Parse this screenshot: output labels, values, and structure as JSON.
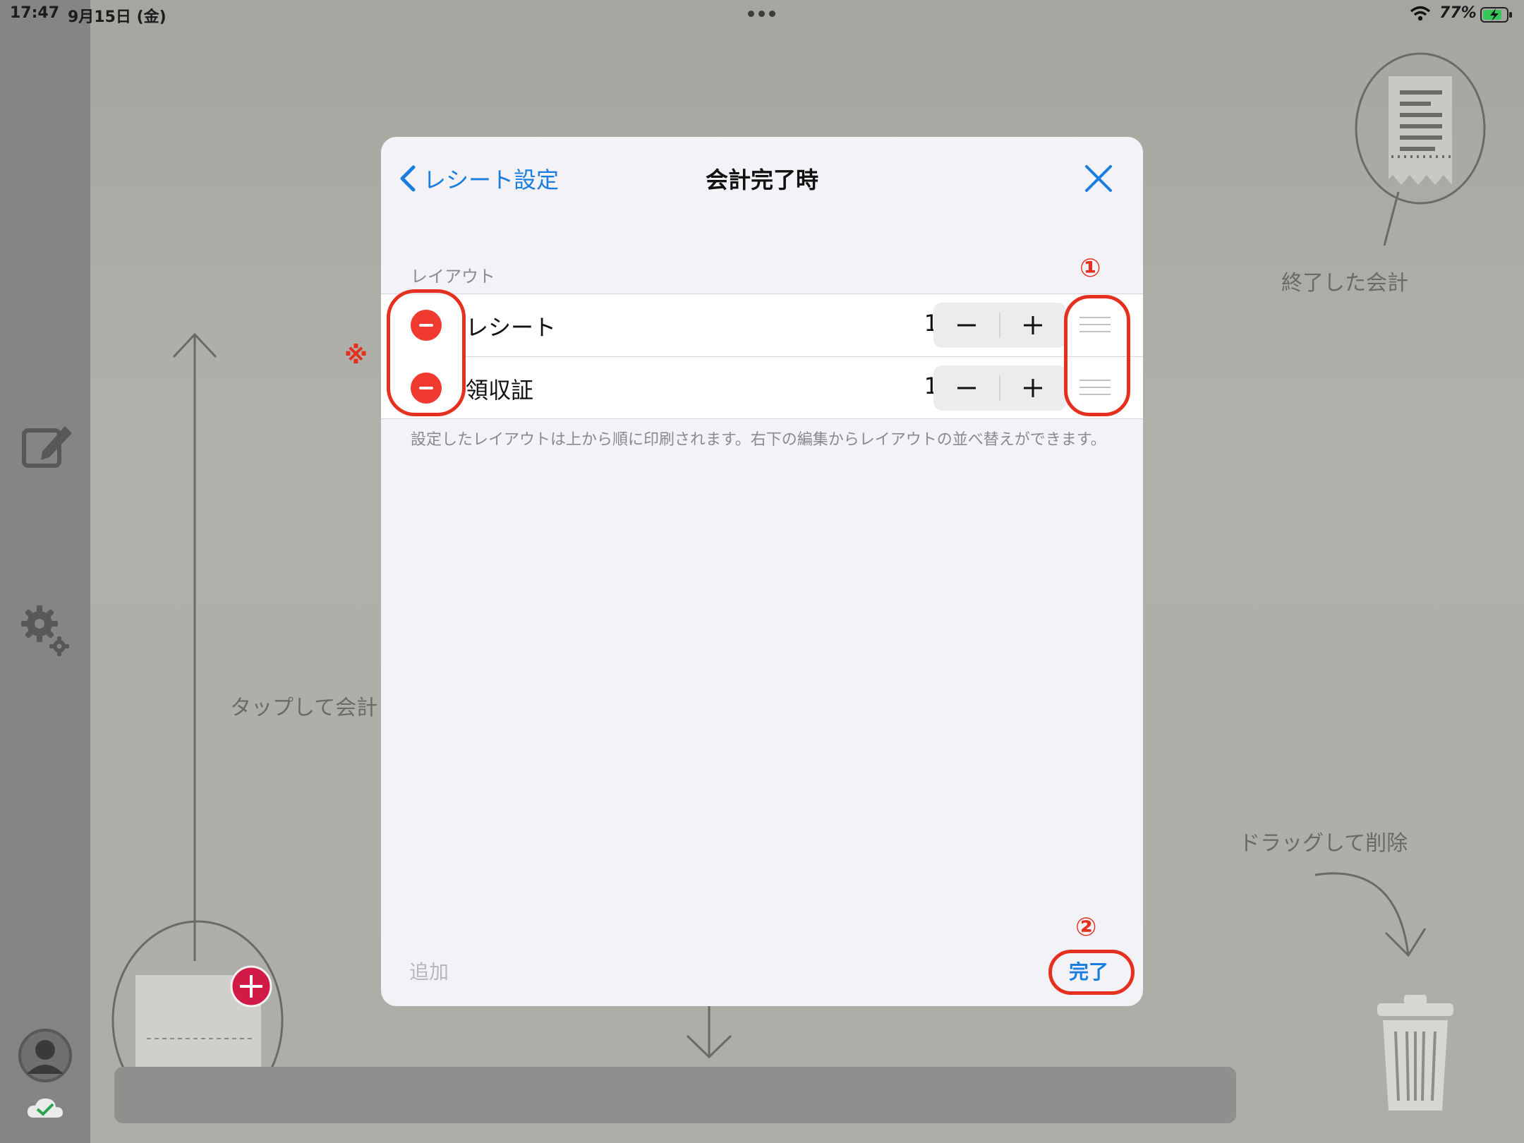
{
  "status_bar": {
    "time": "17:47",
    "date": "9月15日 (金)",
    "battery": "77%"
  },
  "background": {
    "finished_label": "終了した会計",
    "tap_label": "タップして会計",
    "drag_label": "ドラッグして削除"
  },
  "modal": {
    "back_label": "レシート設定",
    "title": "会計完了時",
    "section_header": "レイアウト",
    "rows": [
      {
        "label": "レシート",
        "count": "1"
      },
      {
        "label": "領収証",
        "count": "1"
      }
    ],
    "stepper": {
      "minus": "−",
      "plus": "+"
    },
    "footnote": "設定したレイアウトは上から順に印刷されます。右下の編集からレイアウトの並べ替えができます。",
    "add_label": "追加",
    "done_label": "完了"
  },
  "annotations": {
    "marker_1": "①",
    "marker_2": "②",
    "note_mark": "※"
  },
  "colors": {
    "accent": "#1a7de0",
    "delete": "#f0392f",
    "annotation": "#e53020"
  }
}
